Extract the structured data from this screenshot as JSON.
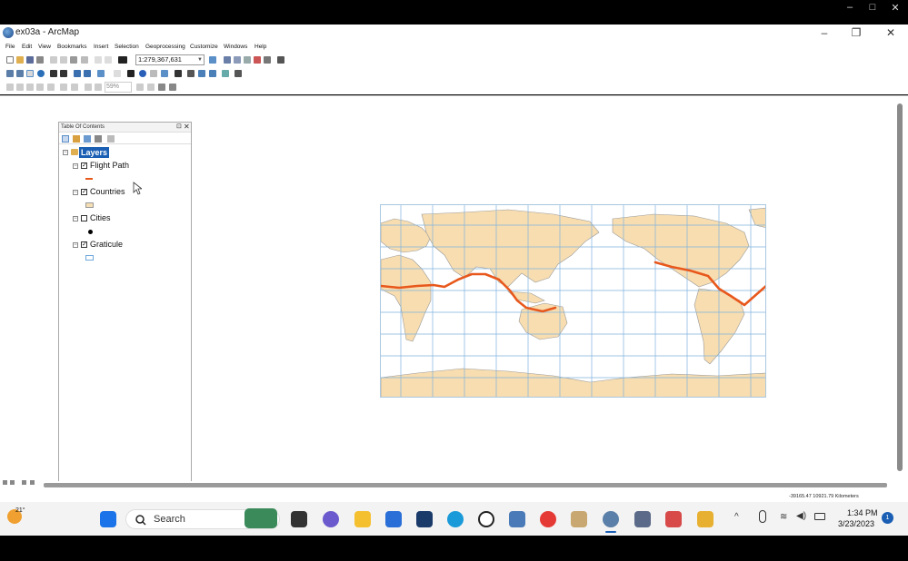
{
  "window": {
    "title": "ex03a - ArcMap"
  },
  "menu": [
    "File",
    "Edit",
    "View",
    "Bookmarks",
    "Insert",
    "Selection",
    "Geoprocessing",
    "Customize",
    "Windows",
    "Help"
  ],
  "toolbar": {
    "scale": "1:279,367,631",
    "zoom": "59%"
  },
  "toc": {
    "title": "Table Of Contents",
    "root": "Layers",
    "layers": [
      {
        "name": "Flight Path",
        "checked": true,
        "symbol_color": "#e8581c"
      },
      {
        "name": "Countries",
        "checked": true,
        "symbol_color": "#f5deb3"
      },
      {
        "name": "Cities",
        "checked": false,
        "symbol_color": "#000000"
      },
      {
        "name": "Graticule",
        "checked": true,
        "symbol_color": "#6fa8dc"
      }
    ]
  },
  "status": {
    "coordinates": "-39165.47  10921.79 Kilometers"
  },
  "taskbar": {
    "weather_temp": "21°",
    "search_label": "Search",
    "time": "1:34 PM",
    "date": "3/23/2023",
    "notification_count": "1"
  },
  "colors": {
    "land": "#f7ddb0",
    "graticule": "#7fb2de",
    "flight_path": "#e8581c",
    "selection": "#1a5fb4"
  }
}
